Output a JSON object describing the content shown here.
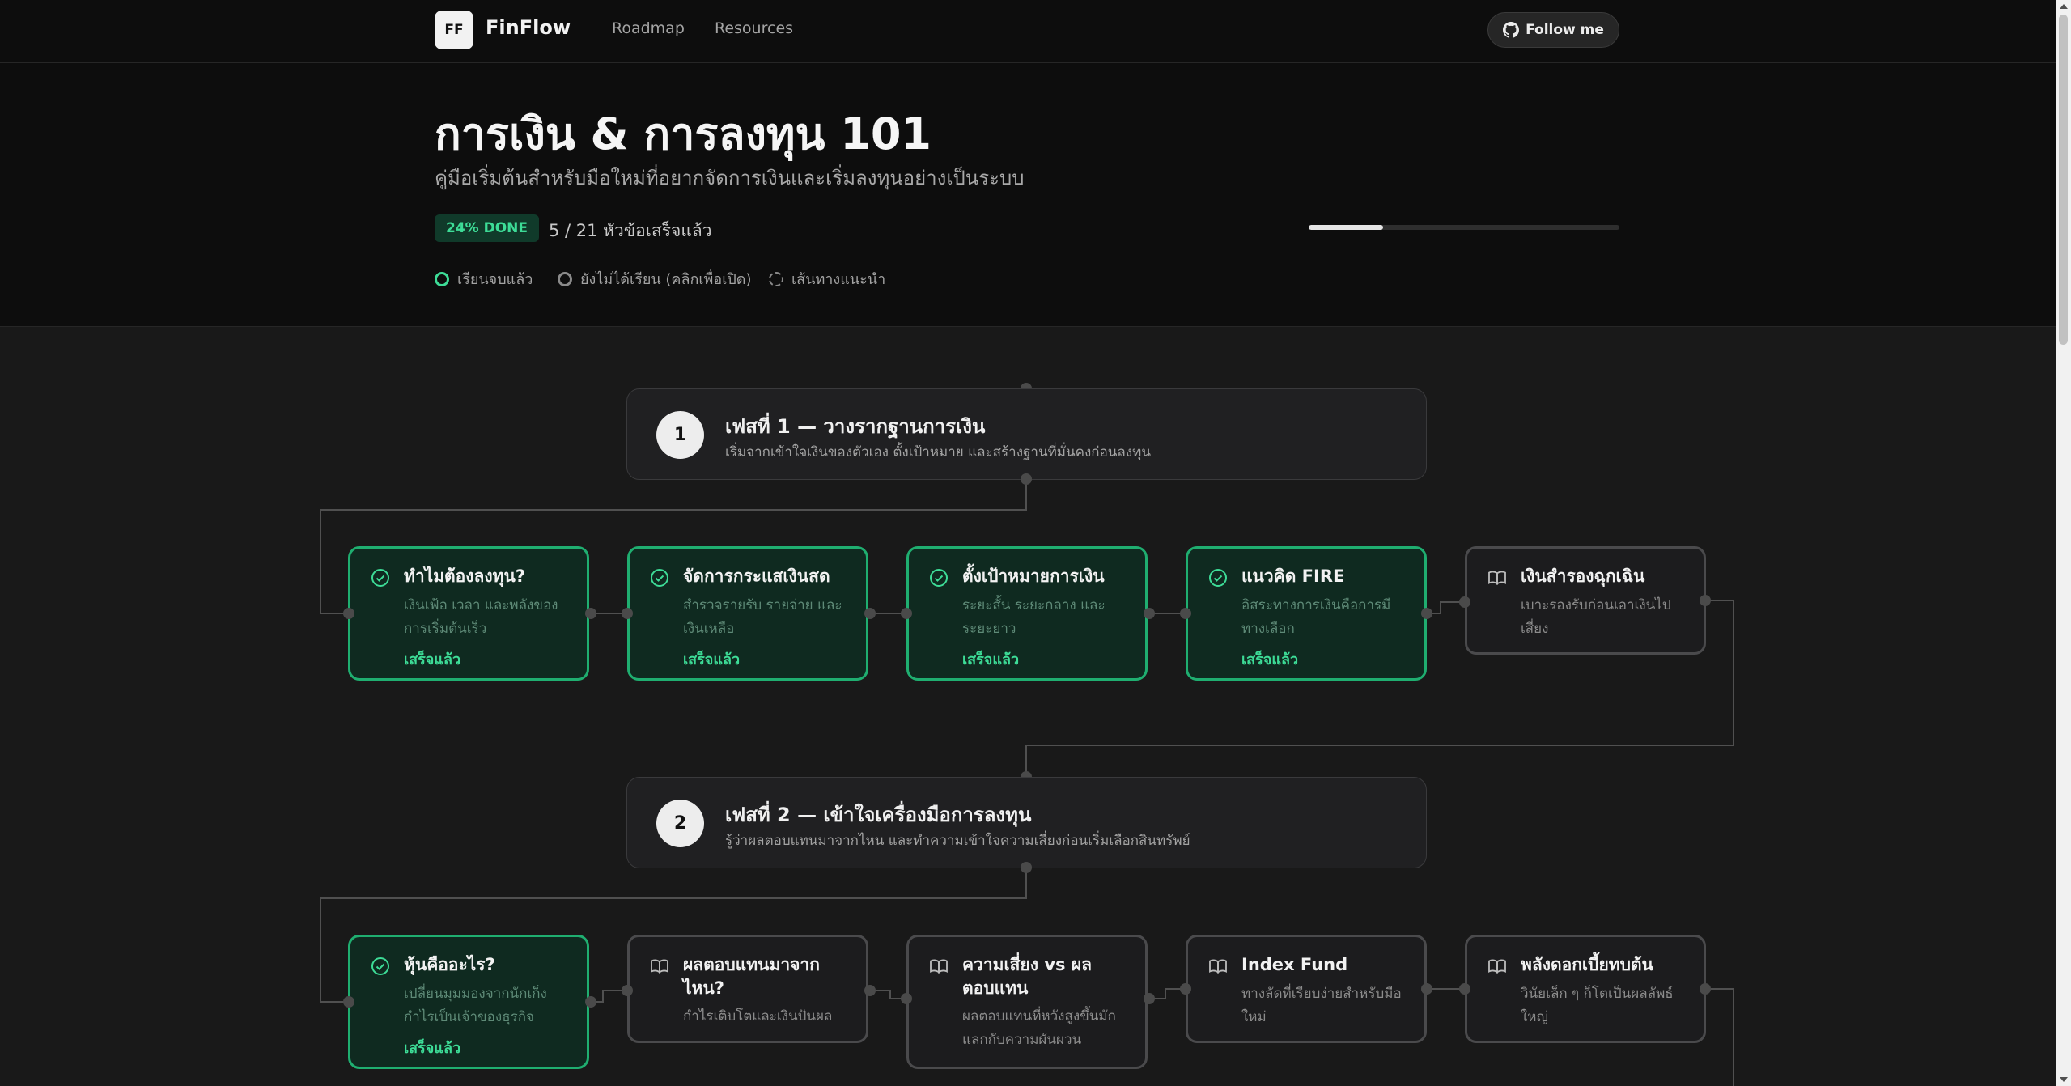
{
  "nav": {
    "logo_badge": "FF",
    "brand": "FinFlow",
    "links": [
      "Roadmap",
      "Resources"
    ],
    "follow_label": "Follow me"
  },
  "header": {
    "title": "การเงิน & การลงทุน 101",
    "subtitle": "คู่มือเริ่มต้นสำหรับมือใหม่ที่อยากจัดการเงินและเริ่มลงทุนอย่างเป็นระบบ",
    "done_badge": "24% DONE",
    "done_text": "5 / 21 หัวข้อเสร็จแล้ว",
    "progress": 0.24,
    "legend": [
      {
        "label": "เรียนจบแล้ว"
      },
      {
        "label": "ยังไม่ได้เรียน (คลิกเพื่อเปิด)"
      },
      {
        "label": "เส้นทางแนะนำ"
      }
    ]
  },
  "colors": {
    "accent": "#3ddc97",
    "done_border": "#1fae70",
    "done_bg": "#0f2a20"
  },
  "phases": [
    {
      "number": "1",
      "title": "เฟสที่ 1 — วางรากฐานการเงิน",
      "desc": "เริ่มจากเข้าใจเงินของตัวเอง ตั้งเป้าหมาย และสร้างฐานที่มั่นคงก่อนลงทุน",
      "topics": [
        {
          "title": "ทำไมต้องลงทุน?",
          "desc": [
            "เงินเฟ้อ เวลา และพลังของ",
            "การเริ่มต้นเร็ว"
          ],
          "status": "เสร็จแล้ว",
          "done": true,
          "icon": "check-circle-icon"
        },
        {
          "title": "จัดการกระแสเงินสด",
          "desc": [
            "สำรวจรายรับ รายจ่าย และ",
            "เงินเหลือ"
          ],
          "status": "เสร็จแล้ว",
          "done": true,
          "icon": "check-circle-icon"
        },
        {
          "title": "ตั้งเป้าหมายการเงิน",
          "desc": [
            "ระยะสั้น ระยะกลาง และ",
            "ระยะยาว"
          ],
          "status": "เสร็จแล้ว",
          "done": true,
          "icon": "check-circle-icon"
        },
        {
          "title": "แนวคิด FIRE",
          "desc": [
            "อิสระทางการเงินคือการมี",
            "ทางเลือก"
          ],
          "status": "เสร็จแล้ว",
          "done": true,
          "icon": "check-circle-icon"
        },
        {
          "title": "เงินสำรองฉุกเฉิน",
          "desc": [
            "เบาะรองรับก่อนเอาเงินไป",
            "เสี่ยง"
          ],
          "status": "",
          "done": false,
          "icon": "book-icon"
        }
      ]
    },
    {
      "number": "2",
      "title": "เฟสที่ 2 — เข้าใจเครื่องมือการลงทุน",
      "desc": "รู้ว่าผลตอบแทนมาจากไหน และทำความเข้าใจความเสี่ยงก่อนเริ่มเลือกสินทรัพย์",
      "topics": [
        {
          "title": "หุ้นคืออะไร?",
          "desc": [
            "เปลี่ยนมุมมองจากนักเก็ง",
            "กำไรเป็นเจ้าของธุรกิจ"
          ],
          "status": "เสร็จแล้ว",
          "done": true,
          "icon": "check-circle-icon"
        },
        {
          "title": "ผลตอบแทนมาจาก ไหน?",
          "desc": [
            "กำไรเติบโตและเงินปันผล"
          ],
          "status": "",
          "done": false,
          "icon": "book-icon"
        },
        {
          "title": "ความเสี่ยง vs ผล ตอบแทน",
          "desc": [
            "ผลตอบแทนที่หวังสูงขึ้นมัก",
            "แลกกับความผันผวน"
          ],
          "status": "",
          "done": false,
          "icon": "book-icon"
        },
        {
          "title": "Index Fund",
          "desc": [
            "ทางลัดที่เรียบง่ายสำหรับมือ",
            "ใหม่"
          ],
          "status": "",
          "done": false,
          "icon": "book-icon"
        },
        {
          "title": "พลังดอกเบี้ยทบต้น",
          "desc": [
            "วินัยเล็ก ๆ ก็โตเป็นผลลัพธ์",
            "ใหญ่"
          ],
          "status": "",
          "done": false,
          "icon": "book-icon"
        }
      ]
    }
  ]
}
